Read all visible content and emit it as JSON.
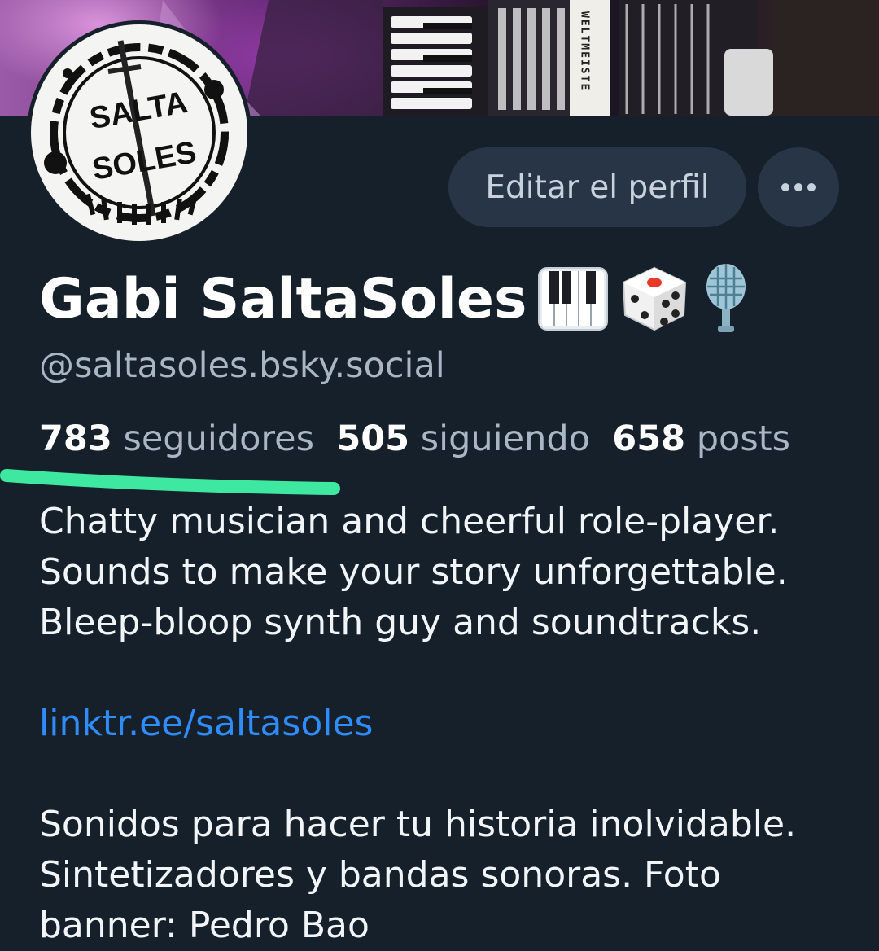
{
  "profile": {
    "display_name": "Gabi SaltaSoles",
    "name_emojis": [
      "piano-keyboard-icon",
      "die-icon",
      "microphone-icon"
    ],
    "handle": "@saltasoles.bsky.social",
    "avatar_text_top": "SALTA",
    "avatar_text_bottom": "SOLES",
    "banner_text": "WELTMEISTE",
    "edit_label": "Editar el perfil",
    "more_label": "•••"
  },
  "stats": {
    "followers_count": "783",
    "followers_label": "seguidores",
    "following_count": "505",
    "following_label": "siguiendo",
    "posts_count": "658",
    "posts_label": "posts"
  },
  "bio": {
    "line1": "Chatty musician and cheerful role-player.",
    "line2": "Sounds to make your story unforgettable.",
    "line3": "Bleep-bloop synth guy and soundtracks.",
    "link": "linktr.ee/saltasoles",
    "line4": "Sonidos para hacer tu historia inolvidable.",
    "line5": "Sintetizadores y bandas sonoras. Foto",
    "line6": "banner: Pedro Bao"
  },
  "colors": {
    "background": "#16202b",
    "button": "#283546",
    "muted_text": "#a9b6c4",
    "link": "#2f8cff",
    "highlight_mark": "#3ee8a0"
  }
}
